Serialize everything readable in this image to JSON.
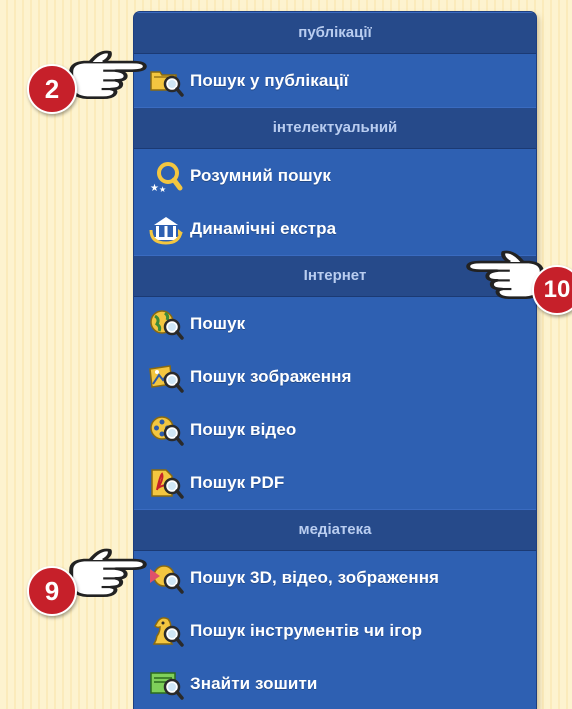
{
  "menu": {
    "sections": [
      {
        "header": "публікації",
        "items": [
          {
            "label": "Пошук у публікації",
            "icon": "folder-search-icon"
          }
        ]
      },
      {
        "header": "інтелектуальний",
        "items": [
          {
            "label": "Розумний пошук",
            "icon": "smart-search-icon"
          },
          {
            "label": "Динамічні екстра",
            "icon": "dynamic-extra-icon"
          }
        ]
      },
      {
        "header": "Інтернет",
        "items": [
          {
            "label": "Пошук",
            "icon": "globe-search-icon"
          },
          {
            "label": "Пошук зображення",
            "icon": "image-search-icon"
          },
          {
            "label": "Пошук відео",
            "icon": "video-search-icon"
          },
          {
            "label": "Пошук PDF",
            "icon": "pdf-search-icon"
          }
        ]
      },
      {
        "header": "медіатека",
        "items": [
          {
            "label": "Пошук 3D, відео, зображення",
            "icon": "media-search-icon"
          },
          {
            "label": "Пошук інструментів чи ігор",
            "icon": "tools-games-search-icon"
          },
          {
            "label": "Знайти зошити",
            "icon": "notebook-search-icon"
          }
        ]
      }
    ]
  },
  "callouts": {
    "a": "2",
    "b": "10",
    "c": "9"
  },
  "colors": {
    "panel": "#2e60b2",
    "header": "#264a8a",
    "badge": "#c6202a",
    "background": "#fdf3cf"
  }
}
